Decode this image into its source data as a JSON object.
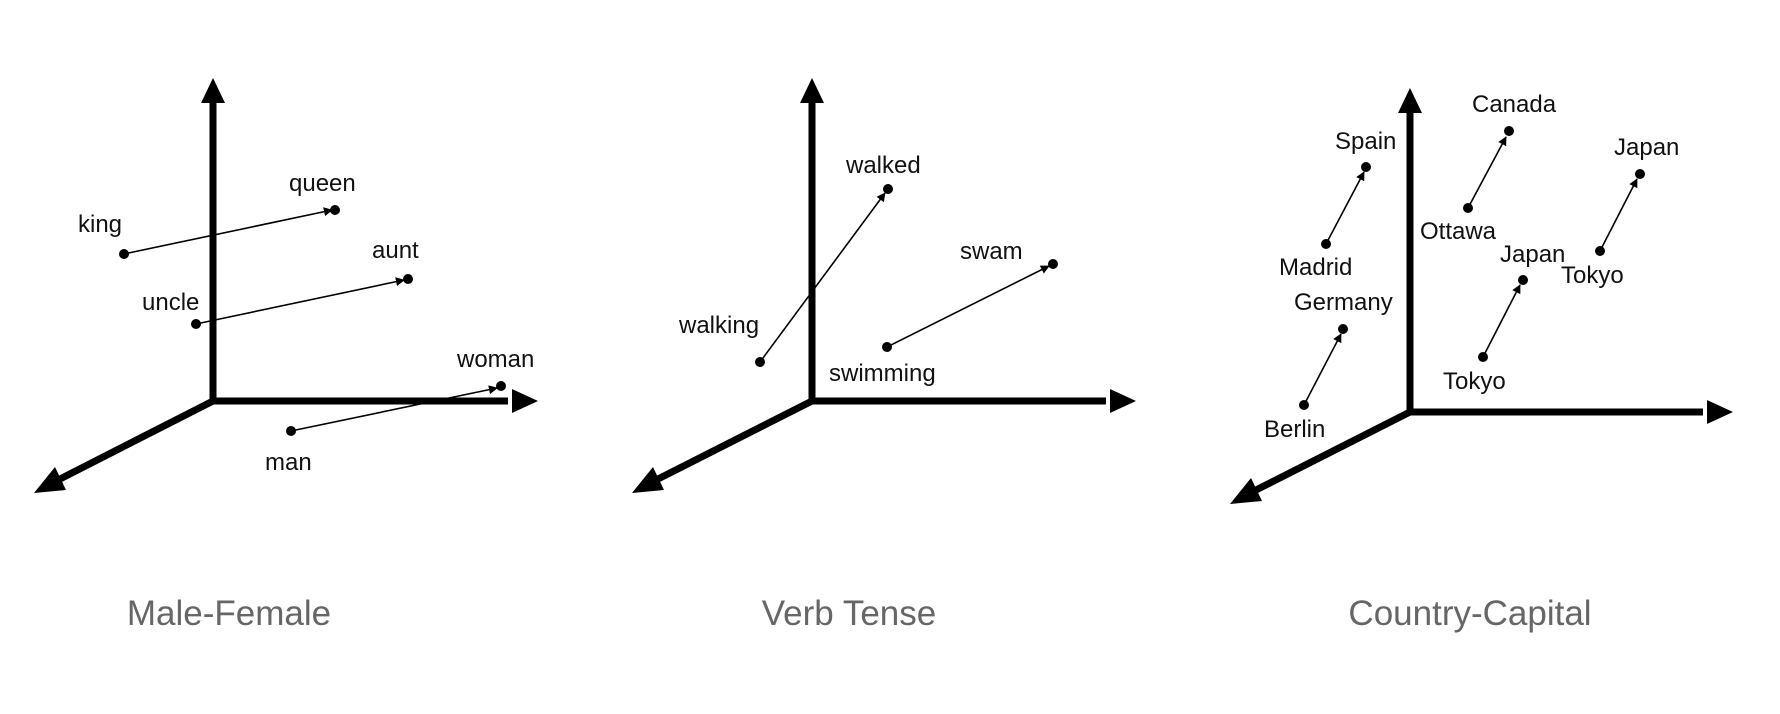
{
  "panels": [
    {
      "id": "male-female",
      "caption": "Male-Female",
      "words": [
        {
          "id": "king",
          "label": "king"
        },
        {
          "id": "queen",
          "label": "queen"
        },
        {
          "id": "uncle",
          "label": "uncle"
        },
        {
          "id": "aunt",
          "label": "aunt"
        },
        {
          "id": "man",
          "label": "man"
        },
        {
          "id": "woman",
          "label": "woman"
        }
      ],
      "relations": [
        {
          "from": "king",
          "to": "queen"
        },
        {
          "from": "uncle",
          "to": "aunt"
        },
        {
          "from": "man",
          "to": "woman"
        }
      ]
    },
    {
      "id": "verb-tense",
      "caption": "Verb Tense",
      "words": [
        {
          "id": "walking",
          "label": "walking"
        },
        {
          "id": "walked",
          "label": "walked"
        },
        {
          "id": "swimming",
          "label": "swimming"
        },
        {
          "id": "swam",
          "label": "swam"
        }
      ],
      "relations": [
        {
          "from": "walking",
          "to": "walked"
        },
        {
          "from": "swimming",
          "to": "swam"
        }
      ]
    },
    {
      "id": "country-capital",
      "caption": "Country-Capital",
      "words": [
        {
          "id": "spain",
          "label": "Spain"
        },
        {
          "id": "madrid",
          "label": "Madrid"
        },
        {
          "id": "germany",
          "label": "Germany"
        },
        {
          "id": "berlin",
          "label": "Berlin"
        },
        {
          "id": "canada",
          "label": "Canada"
        },
        {
          "id": "ottawa",
          "label": "Ottawa"
        },
        {
          "id": "japan-1",
          "label": "Japan"
        },
        {
          "id": "tokyo-1",
          "label": "Tokyo"
        },
        {
          "id": "japan-2",
          "label": "Japan"
        },
        {
          "id": "tokyo-2",
          "label": "Tokyo"
        }
      ],
      "relations": [
        {
          "from": "madrid",
          "to": "spain"
        },
        {
          "from": "berlin",
          "to": "germany"
        },
        {
          "from": "ottawa",
          "to": "canada"
        },
        {
          "from": "tokyo-1",
          "to": "japan-1"
        },
        {
          "from": "tokyo-2",
          "to": "japan-2"
        }
      ]
    }
  ]
}
